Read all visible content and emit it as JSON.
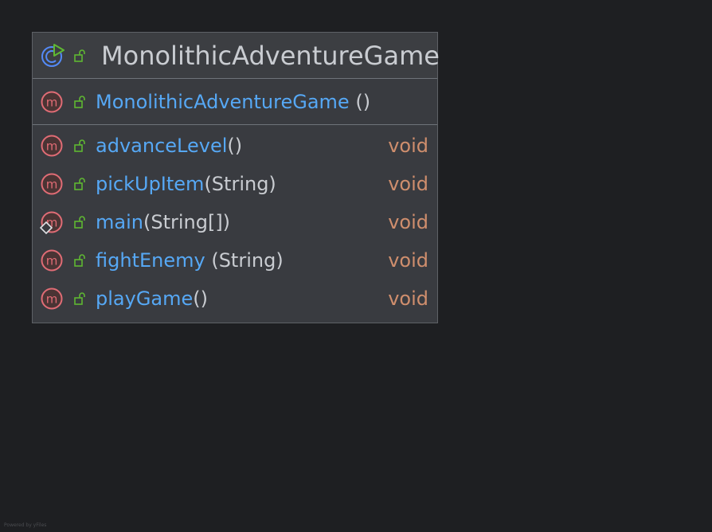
{
  "diagram": {
    "class": {
      "name": "MonolithicAdventureGame",
      "icon": "class-runnable-icon",
      "visibility_icon": "public-lock-icon"
    },
    "constructor": {
      "name": "MonolithicAdventureGame",
      "params": " ()",
      "icon": "method-icon"
    },
    "methods": [
      {
        "name": "advanceLevel",
        "params": "()",
        "return_type": "void"
      },
      {
        "name": "pickUpItem",
        "params": "(String)",
        "return_type": "void"
      },
      {
        "name": "main",
        "params": "(String[])",
        "return_type": "void"
      },
      {
        "name": "fightEnemy",
        "params": " (String)",
        "return_type": "void"
      },
      {
        "name": "playGame",
        "params": "()",
        "return_type": "void"
      }
    ],
    "colors": {
      "background": "#1e1f22",
      "node": "#393b40",
      "method_name": "#56a8f5",
      "return_type": "#cf8e6d",
      "method_icon": "#e06c75",
      "public_icon": "#5fb832",
      "class_icon": "#548af7"
    },
    "watermark": "Powered by yFiles"
  }
}
